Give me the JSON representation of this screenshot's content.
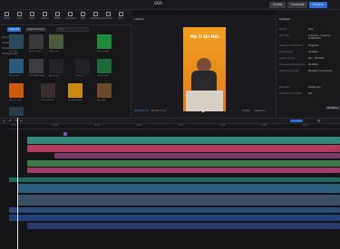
{
  "window": {
    "title": "GOA"
  },
  "titlebar": {
    "buttons": [
      {
        "label": "Scelta",
        "color": "#3a3a40"
      },
      {
        "label": "Condividi",
        "color": "#3a3a40"
      },
      {
        "label": "Esporta",
        "color": "#2b6fd6"
      }
    ]
  },
  "toolbar": {
    "tools": [
      "Media",
      "Audio",
      "Testo",
      "Adesivi",
      "Effetti",
      "Transizioni",
      "Filtri",
      "Regolazione",
      "Modelli",
      "Altro"
    ]
  },
  "media": {
    "tabs": [
      "Importa",
      "Registrazione"
    ],
    "sidebar": [
      "Importato",
      "Libreria",
      "Preset",
      "Collegamento"
    ],
    "search_placeholder": "Cerca",
    "thumbs": [
      {
        "label": "FC_ITW9_...",
        "color": "#2a4a5a"
      },
      {
        "label": "Flix_01.mp4",
        "color": "#3a3a3a"
      },
      {
        "label": "Solo_Lima",
        "color": "#4b5a3a"
      },
      {
        "label": "Solo_ok.mp4",
        "color": "#1f8a3a"
      },
      {
        "label": "Abecedario",
        "color": "#2b5b7a"
      },
      {
        "label": "FC_ITW8ok.mp4",
        "color": "#3c3c42"
      },
      {
        "label": "Bg_ora_di_...",
        "color": "#23252b"
      },
      {
        "label": "Cavo_di_...",
        "color": "#222226"
      },
      {
        "label": "Scatto.mp4",
        "color": "#1d6a3d"
      },
      {
        "label": "Sole_01.mp4",
        "color": "#c95a12"
      },
      {
        "label": "Glow_04.mp4",
        "color": "#3a2e2e"
      },
      {
        "label": "Sunflower.mp4",
        "color": "#c98a14"
      },
      {
        "label": "Boa.mp4",
        "color": "#6a4a2a"
      },
      {
        "label": "FC_ITW7.mp4",
        "color": "#2f3a48"
      }
    ]
  },
  "player": {
    "title": "Lettore",
    "caption": "MA TI SEI MAI",
    "time": "00:00:07:18",
    "duration": "00:02:27:22",
    "buttons": [
      "Adatta",
      "Rapporto"
    ]
  },
  "details": {
    "title": "Dettagli",
    "rows": [
      {
        "key": "Nome:",
        "value": "GOA"
      },
      {
        "key": "Percorso:",
        "value": "C:/Users/.../CapCut Drafts/GOA"
      },
      {
        "key": "Rapporto dimensioni:",
        "value": "Originale"
      },
      {
        "key": "Risoluzione:",
        "value": "Adattata"
      },
      {
        "key": "Spazio colore:",
        "value": "Rec. 709 SDR"
      },
      {
        "key": "Frequenza fotogrammi:",
        "value": "30.00fps"
      },
      {
        "key": "Importa progetto:",
        "value": "Mantieni la posizione"
      },
      {
        "key": "Modalità:",
        "value": "Disattivato"
      },
      {
        "key": "Dimensione del file:",
        "value": "N/A"
      }
    ],
    "button": "Modifica"
  },
  "timeline": {
    "ticks": [
      "00:00",
      "00:20",
      "00:40",
      "01:00",
      "01:20",
      "01:40",
      "02:00",
      "02:20"
    ],
    "playhead_time": "00:00:07:18"
  }
}
